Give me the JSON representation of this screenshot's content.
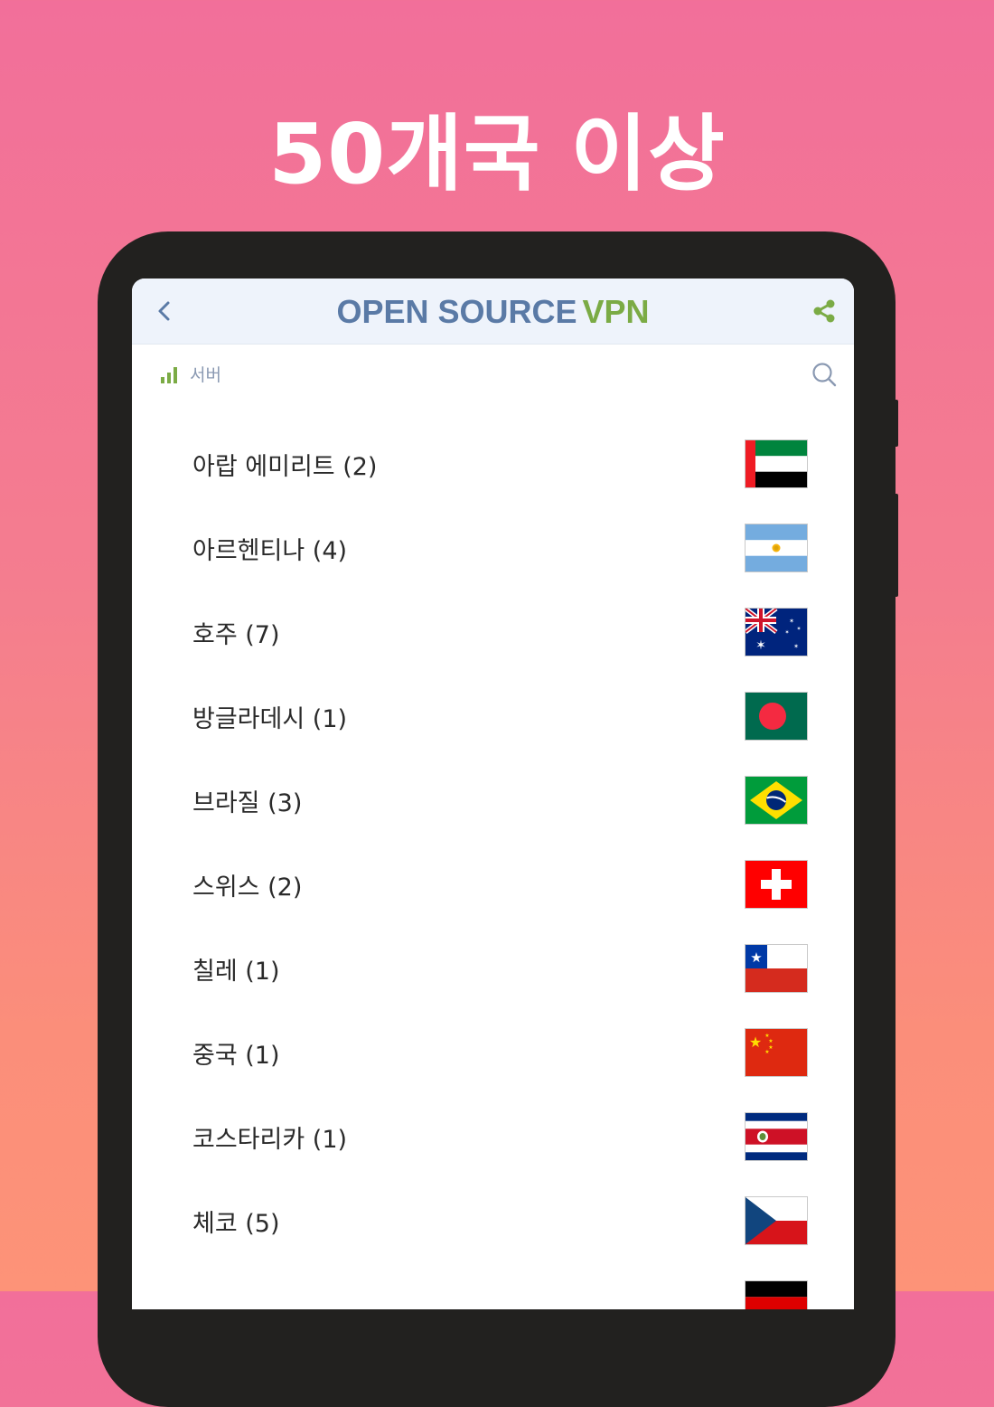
{
  "headline": "50개국 이상",
  "app": {
    "title_part1": "OPEN SOURCE",
    "title_part2": "VPN",
    "back_icon": "chevron-left-icon",
    "share_icon": "share-icon",
    "colors": {
      "primary": "#5a7aa6",
      "accent": "#7bab45"
    }
  },
  "servers": {
    "label": "서버",
    "signal_icon": "signal-icon",
    "search_icon": "search-icon"
  },
  "countries": [
    {
      "name": "아랍 에미리트 (2)",
      "flag": "uae"
    },
    {
      "name": "아르헨티나 (4)",
      "flag": "argentina"
    },
    {
      "name": "호주 (7)",
      "flag": "australia"
    },
    {
      "name": "방글라데시 (1)",
      "flag": "bangladesh"
    },
    {
      "name": "브라질 (3)",
      "flag": "brazil"
    },
    {
      "name": "스위스 (2)",
      "flag": "switzerland"
    },
    {
      "name": "칠레 (1)",
      "flag": "chile"
    },
    {
      "name": "중국 (1)",
      "flag": "china"
    },
    {
      "name": "코스타리카 (1)",
      "flag": "costa-rica"
    },
    {
      "name": "체코 (5)",
      "flag": "czech"
    }
  ]
}
